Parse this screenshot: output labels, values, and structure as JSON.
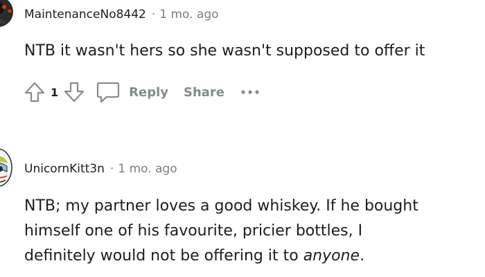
{
  "comments": [
    {
      "username": "MaintenanceNo8442",
      "separator": "·",
      "time": "1 mo. ago",
      "body": "NTB it wasn't hers so she wasn't supposed to offer it",
      "vote_count": "1",
      "reply_label": "Reply",
      "share_label": "Share"
    },
    {
      "username": "UnicornKitt3n",
      "separator": "·",
      "time": "1 mo. ago",
      "body_lines": [
        "NTB; my partner loves a good whiskey. If he bought",
        "himself one of his favourite, pricier bottles, I",
        "definitely would not be offering it to "
      ],
      "body_emphasis": "anyone",
      "body_end": "."
    }
  ],
  "icons": {
    "upvote": "upvote-arrow-icon",
    "downvote": "downvote-arrow-icon",
    "comment": "comment-bubble-icon",
    "more": "more-dots-icon"
  },
  "colors": {
    "text": "#1c1c1c",
    "meta": "#7c7c7c",
    "action": "#878a8c"
  }
}
